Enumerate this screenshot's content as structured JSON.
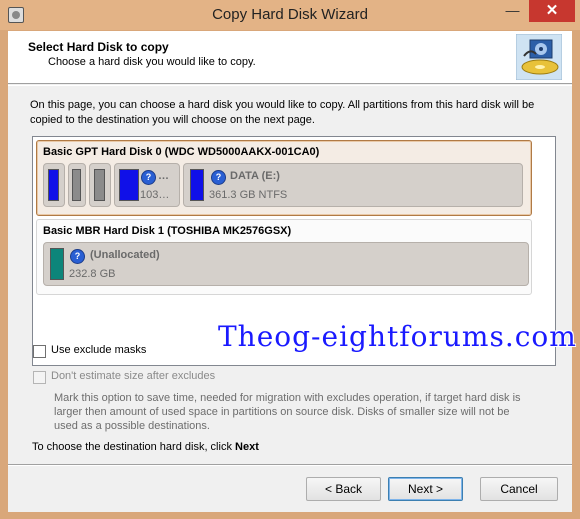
{
  "window": {
    "title": "Copy Hard Disk Wizard",
    "minimize_glyph": "—",
    "close_glyph": "✕"
  },
  "header": {
    "title": "Select Hard Disk to copy",
    "subtitle": "Choose a hard disk you would like to copy.",
    "icon": "disk-copy-logo-icon"
  },
  "intro_text": "On this page, you can choose a hard disk you would like to copy. All partitions from this hard disk will be copied to the destination you will choose on the next page.",
  "disks": [
    {
      "title": "Basic GPT Hard Disk 0 (WDC WD5000AAKX-001CA0)",
      "selected": true,
      "partitions": [
        {
          "name": "…",
          "size": "103…",
          "color": "#1010e8"
        },
        {
          "name": "DATA (E:)",
          "size": "361.3 GB NTFS",
          "color": "#1010e8"
        }
      ]
    },
    {
      "title": "Basic MBR Hard Disk 1 (TOSHIBA MK2576GSX)",
      "selected": false,
      "partitions": [
        {
          "name": "(Unallocated)",
          "size": "232.8 GB",
          "color": "#0d857a"
        }
      ]
    }
  ],
  "options": {
    "exclude_masks": {
      "label": "Use exclude masks",
      "checked": false,
      "enabled": true
    },
    "dont_estimate": {
      "label": "Don't estimate size after excludes",
      "checked": false,
      "enabled": false
    },
    "hint": "Mark this option to save time, needed for migration with excludes operation, if target hard disk is larger then amount of used space in partitions on source disk. Disks of smaller size will not be used as a possible destinations."
  },
  "next_instruction": {
    "text": "To choose the destination hard disk, click",
    "bold": "Next"
  },
  "buttons": {
    "back": "< Back",
    "next": "Next >",
    "cancel": "Cancel"
  },
  "watermark": "Theog-eightforums.com"
}
